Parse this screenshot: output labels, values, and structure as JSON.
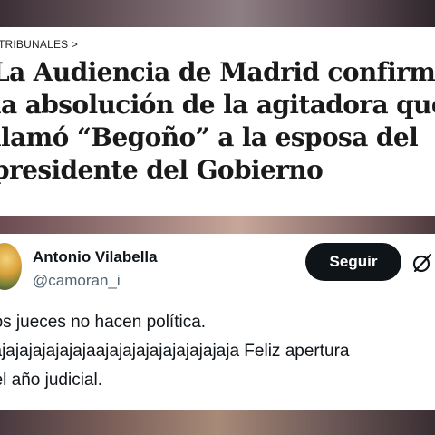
{
  "article": {
    "breadcrumb": "TRIBUNALES >",
    "headline_lines": [
      "La Audiencia de Madrid confirma",
      "la absolución de la agitadora que",
      "llamó “Begoño” a la esposa del",
      "presidente del Gobierno"
    ]
  },
  "tweet": {
    "display_name": "Antonio Vilabella",
    "handle": "@camoran_i",
    "follow_label": "Seguir",
    "icon": "grok-icon",
    "text_lines": [
      "Los jueces no hacen política.",
      "Jajajajajajajajaajajajajajajajajajaja Feliz apertura",
      "del año judicial."
    ]
  },
  "colors": {
    "follow_bg": "#0f1419",
    "text_primary": "#0f1419",
    "text_secondary": "#536471"
  }
}
